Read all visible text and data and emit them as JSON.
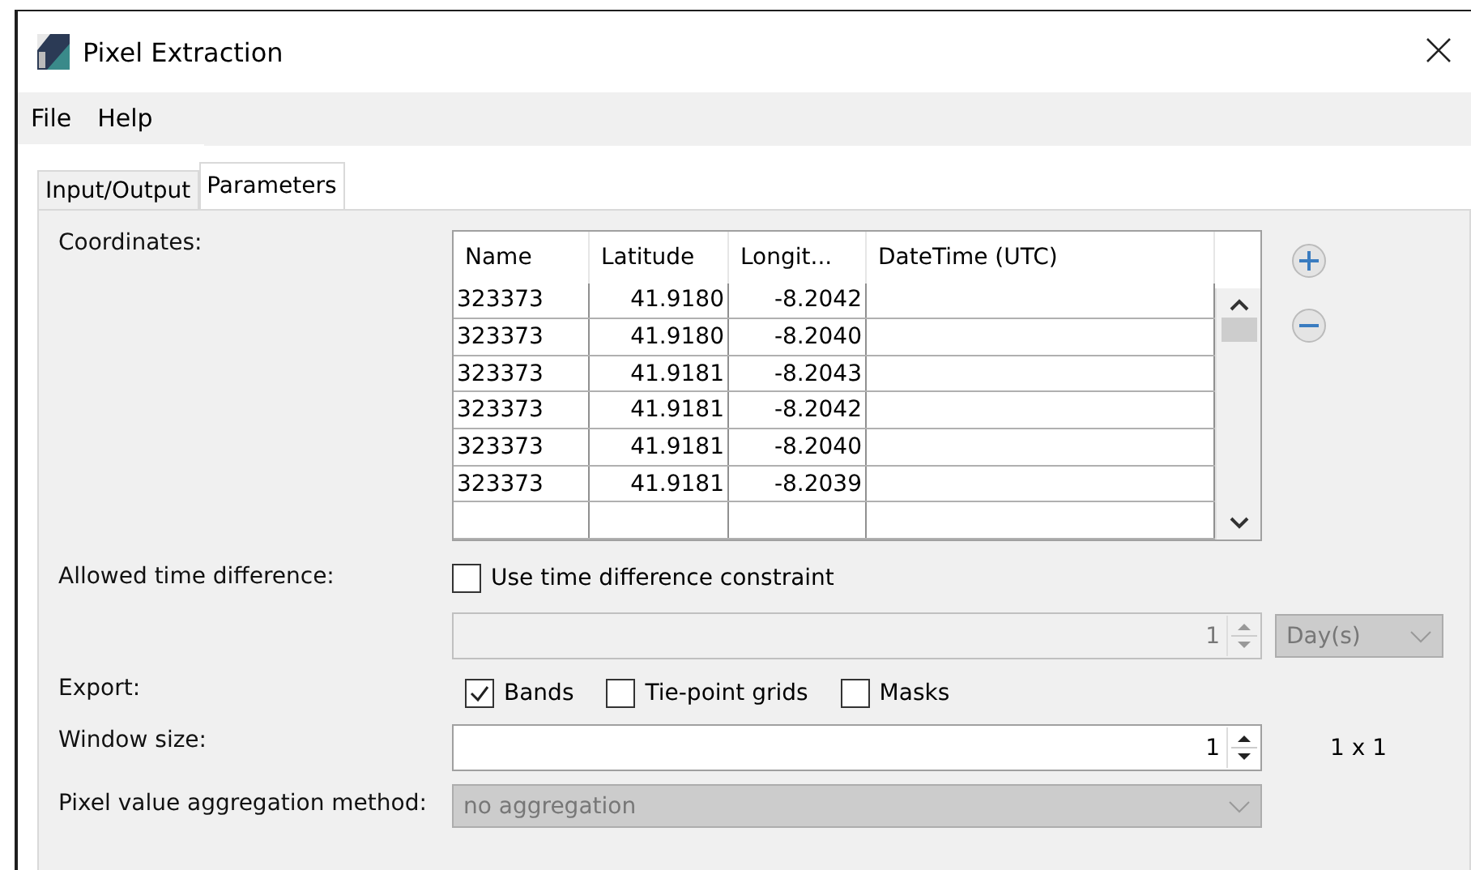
{
  "window": {
    "title": "Pixel Extraction"
  },
  "menu": [
    "File",
    "Help"
  ],
  "tabs": [
    {
      "label": "Input/Output",
      "selected": false
    },
    {
      "label": "Parameters",
      "selected": true
    }
  ],
  "coordinates": {
    "label": "Coordinates:",
    "columns": [
      "Name",
      "Latitude",
      "Longit...",
      "DateTime (UTC)"
    ],
    "rows": [
      [
        "323373",
        "41.9180",
        "-8.2042",
        ""
      ],
      [
        "323373",
        "41.9180",
        "-8.2040",
        ""
      ],
      [
        "323373",
        "41.9181",
        "-8.2043",
        ""
      ],
      [
        "323373",
        "41.9181",
        "-8.2042",
        ""
      ],
      [
        "323373",
        "41.9181",
        "-8.2040",
        ""
      ],
      [
        "323373",
        "41.9181",
        "-8.2039",
        ""
      ]
    ]
  },
  "time_difference": {
    "label": "Allowed time difference:",
    "checkbox": {
      "label": "Use time difference constraint",
      "checked": false
    },
    "value": "1",
    "unit": "Day(s)",
    "disabled": true
  },
  "export": {
    "label": "Export:",
    "options": [
      {
        "label": "Bands",
        "checked": true
      },
      {
        "label": "Tie-point grids",
        "checked": false
      },
      {
        "label": "Masks",
        "checked": false
      }
    ]
  },
  "window_size": {
    "label": "Window size:",
    "value": "1",
    "reading": "1 x 1"
  },
  "aggregation": {
    "label": "Pixel value aggregation method:",
    "value": "no aggregation",
    "disabled": true
  }
}
